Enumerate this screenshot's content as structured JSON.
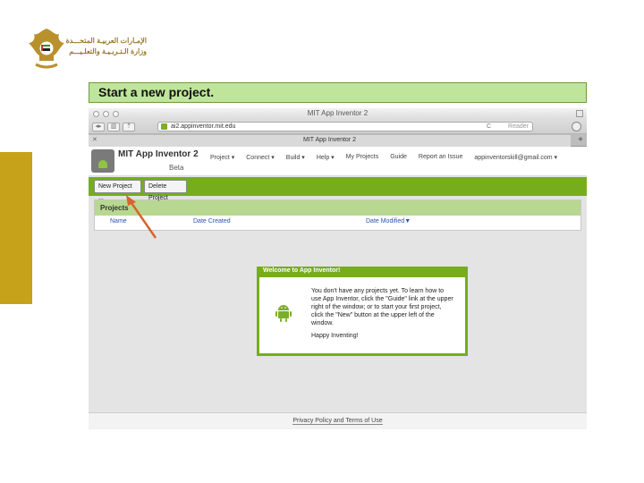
{
  "slide": {
    "title": "Start a new project."
  },
  "ministry": {
    "line1": "الإمـارات العربيـة المتحـــدة",
    "line2": "وزارة الـتـربـيـة والتعلـيـــم"
  },
  "browser": {
    "window_title": "MIT App Inventor 2",
    "url": "ai2.appinventor.mit.edu",
    "reader_label": "Reader",
    "reload_icon": "C",
    "tab_title": "MIT App Inventor 2",
    "new_tab": "+"
  },
  "app": {
    "name": "MIT App Inventor 2",
    "badge": "Beta",
    "menu": [
      "Project ▾",
      "Connect ▾",
      "Build ▾",
      "Help ▾",
      "My Projects",
      "Guide",
      "Report an Issue",
      "appinventorskill@gmail.com ▾"
    ],
    "buttons": {
      "new_project": "New Project ...",
      "delete_project": "Delete Project"
    },
    "projects": {
      "heading": "Projects",
      "columns": [
        "Name",
        "Date Created",
        "Date Modified▼"
      ]
    },
    "dialog": {
      "title": "Welcome to App Inventor!",
      "message": "You don't have any projects yet. To learn how to use App Inventor, click the \"Guide\" link at the upper right of the window; or to start your first project, click the \"New\" button at the upper left of the window.",
      "signoff": "Happy Inventing!"
    },
    "footer": "Privacy Policy and Terms of Use"
  },
  "colors": {
    "accent_green": "#76ad1c",
    "gold": "#c5a219",
    "arrow": "#d9632b"
  }
}
